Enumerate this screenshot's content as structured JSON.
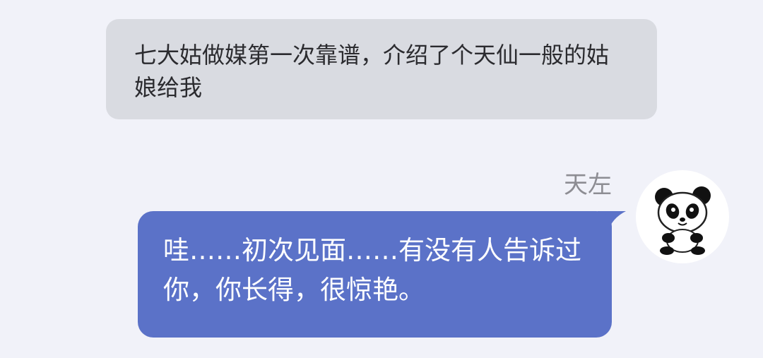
{
  "messages": [
    {
      "direction": "incoming",
      "text": "七大姑做媒第一次靠谱，介绍了个天仙一般的姑娘给我"
    },
    {
      "direction": "outgoing",
      "sender": "天左",
      "avatar_icon": "panda-avatar-icon",
      "text": "哇……初次见面……有没有人告诉过你，你长得，很惊艳。"
    }
  ],
  "colors": {
    "background": "#f1f2f9",
    "incoming_bubble": "#d9dbe1",
    "outgoing_bubble": "#5b72c8",
    "sender_name": "#8d8d93"
  }
}
